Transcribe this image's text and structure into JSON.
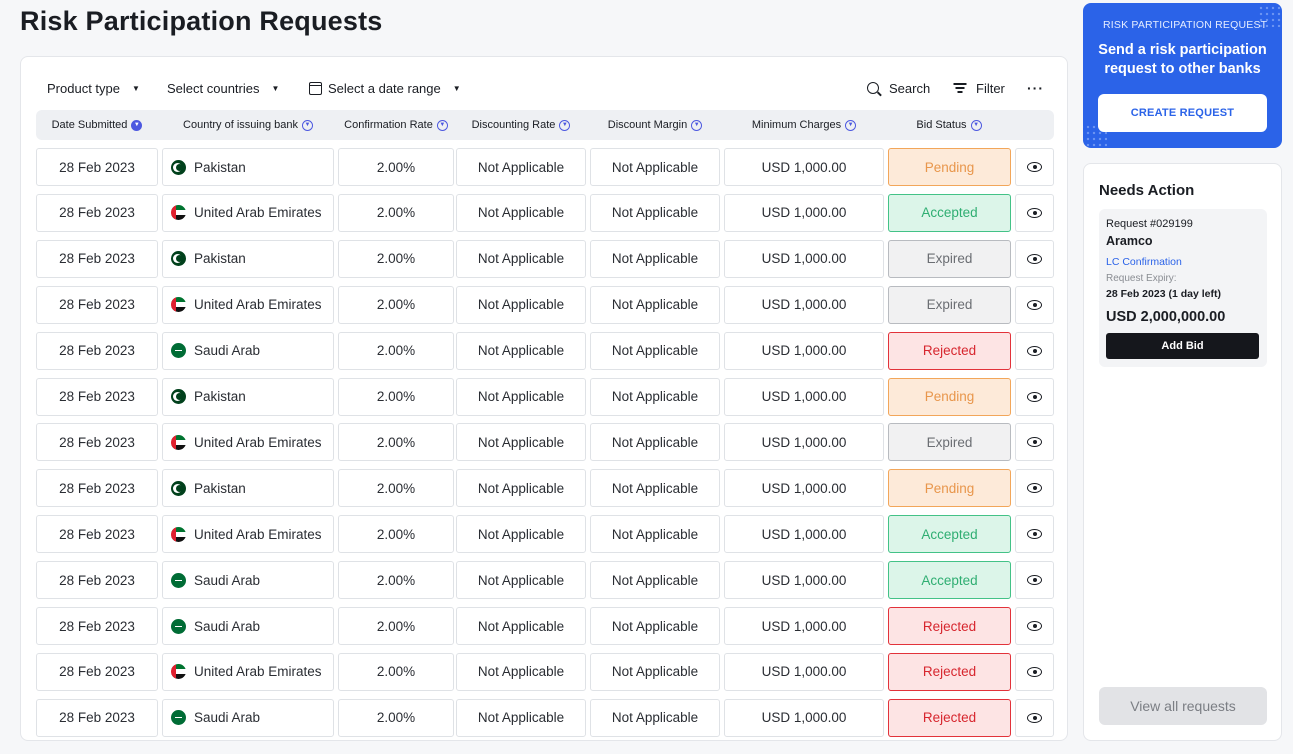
{
  "page": {
    "title": "Risk Participation Requests"
  },
  "toolbar": {
    "product_type": "Product type",
    "countries": "Select countries",
    "date_range": "Select a date range",
    "search": "Search",
    "filter": "Filter"
  },
  "table": {
    "columns": [
      "Date Submitted",
      "Country of issuing bank",
      "Confirmation Rate",
      "Discounting Rate",
      "Discount Margin",
      "Minimum Charges",
      "Bid Status"
    ],
    "rows": [
      {
        "date": "28 Feb 2023",
        "country": "Pakistan",
        "flag": "pk",
        "confirmation_rate": "2.00%",
        "discounting_rate": "Not Applicable",
        "discount_margin": "Not Applicable",
        "minimum_charges": "USD 1,000.00",
        "status": "Pending",
        "status_class": "pending"
      },
      {
        "date": "28 Feb 2023",
        "country": "United Arab Emirates",
        "flag": "ae",
        "confirmation_rate": "2.00%",
        "discounting_rate": "Not Applicable",
        "discount_margin": "Not Applicable",
        "minimum_charges": "USD 1,000.00",
        "status": "Accepted",
        "status_class": "accepted"
      },
      {
        "date": "28 Feb 2023",
        "country": "Pakistan",
        "flag": "pk",
        "confirmation_rate": "2.00%",
        "discounting_rate": "Not Applicable",
        "discount_margin": "Not Applicable",
        "minimum_charges": "USD 1,000.00",
        "status": "Expired",
        "status_class": "expired"
      },
      {
        "date": "28 Feb 2023",
        "country": "United Arab Emirates",
        "flag": "ae",
        "confirmation_rate": "2.00%",
        "discounting_rate": "Not Applicable",
        "discount_margin": "Not Applicable",
        "minimum_charges": "USD 1,000.00",
        "status": "Expired",
        "status_class": "expired"
      },
      {
        "date": "28 Feb 2023",
        "country": "Saudi Arab",
        "flag": "sa",
        "confirmation_rate": "2.00%",
        "discounting_rate": "Not Applicable",
        "discount_margin": "Not Applicable",
        "minimum_charges": "USD 1,000.00",
        "status": "Rejected",
        "status_class": "rejected"
      },
      {
        "date": "28 Feb 2023",
        "country": "Pakistan",
        "flag": "pk",
        "confirmation_rate": "2.00%",
        "discounting_rate": "Not Applicable",
        "discount_margin": "Not Applicable",
        "minimum_charges": "USD 1,000.00",
        "status": "Pending",
        "status_class": "pending"
      },
      {
        "date": "28 Feb 2023",
        "country": "United Arab Emirates",
        "flag": "ae",
        "confirmation_rate": "2.00%",
        "discounting_rate": "Not Applicable",
        "discount_margin": "Not Applicable",
        "minimum_charges": "USD 1,000.00",
        "status": "Expired",
        "status_class": "expired"
      },
      {
        "date": "28 Feb 2023",
        "country": "Pakistan",
        "flag": "pk",
        "confirmation_rate": "2.00%",
        "discounting_rate": "Not Applicable",
        "discount_margin": "Not Applicable",
        "minimum_charges": "USD 1,000.00",
        "status": "Pending",
        "status_class": "pending"
      },
      {
        "date": "28 Feb 2023",
        "country": "United Arab Emirates",
        "flag": "ae",
        "confirmation_rate": "2.00%",
        "discounting_rate": "Not Applicable",
        "discount_margin": "Not Applicable",
        "minimum_charges": "USD 1,000.00",
        "status": "Accepted",
        "status_class": "accepted"
      },
      {
        "date": "28 Feb 2023",
        "country": "Saudi Arab",
        "flag": "sa",
        "confirmation_rate": "2.00%",
        "discounting_rate": "Not Applicable",
        "discount_margin": "Not Applicable",
        "minimum_charges": "USD 1,000.00",
        "status": "Accepted",
        "status_class": "accepted"
      },
      {
        "date": "28 Feb 2023",
        "country": "Saudi Arab",
        "flag": "sa",
        "confirmation_rate": "2.00%",
        "discounting_rate": "Not Applicable",
        "discount_margin": "Not Applicable",
        "minimum_charges": "USD 1,000.00",
        "status": "Rejected",
        "status_class": "rejected"
      },
      {
        "date": "28 Feb 2023",
        "country": "United Arab Emirates",
        "flag": "ae",
        "confirmation_rate": "2.00%",
        "discounting_rate": "Not Applicable",
        "discount_margin": "Not Applicable",
        "minimum_charges": "USD 1,000.00",
        "status": "Rejected",
        "status_class": "rejected"
      },
      {
        "date": "28 Feb 2023",
        "country": "Saudi Arab",
        "flag": "sa",
        "confirmation_rate": "2.00%",
        "discounting_rate": "Not Applicable",
        "discount_margin": "Not Applicable",
        "minimum_charges": "USD 1,000.00",
        "status": "Rejected",
        "status_class": "rejected"
      }
    ]
  },
  "promo": {
    "label": "RISK PARTICIPATION REQUEST",
    "text": "Send a risk participation request to other banks",
    "button": "CREATE REQUEST"
  },
  "needs_action": {
    "title": "Needs Action",
    "request_id": "Request #029199",
    "company": "Aramco",
    "type": "LC Confirmation",
    "expiry_label": "Request Expiry:",
    "expiry": "28 Feb 2023 (1 day left)",
    "amount": "USD 2,000,000.00",
    "bid_button": "Add Bid",
    "view_all": "View all requests"
  },
  "colors": {
    "accent": "#2b63e8",
    "pending": "#e8964b",
    "accepted": "#2fae72",
    "expired": "#6b6e73",
    "rejected": "#d7262e"
  }
}
